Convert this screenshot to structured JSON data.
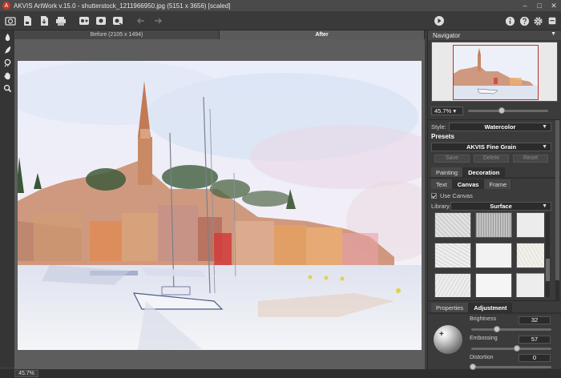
{
  "window": {
    "title": "AKVIS ArtWork v.15.0 - shutterstock_1211966950.jpg (5151 x 3656) [scaled]",
    "logo_letter": "A",
    "minimize": "–",
    "maximize": "□",
    "close": "✕"
  },
  "toolbar": {
    "left_icons": [
      "open-icon",
      "save-icon",
      "export-icon",
      "print-icon",
      "batch-icon",
      "share-icon",
      "settings-icon",
      "undo-icon",
      "redo-icon"
    ],
    "right_icons": [
      "run-icon",
      "info-icon",
      "help-icon",
      "settings-gear-icon",
      "notifications-icon"
    ]
  },
  "left_tools": [
    "brush-icon",
    "smudge-icon",
    "eraser-icon",
    "hand-icon",
    "zoom-icon"
  ],
  "view_tabs": {
    "before": "Before (2105 x 1494)",
    "after": "After"
  },
  "status": {
    "zoom": "45.7%"
  },
  "navigator": {
    "title": "Navigator",
    "zoom": "45.7%",
    "zoom_slider_fraction": 0.42
  },
  "settings": {
    "style_label": "Style:",
    "style_value": "Watercolor",
    "presets_title": "Presets",
    "preset_value": "AKVIS Fine Grain",
    "save_button": "Save",
    "delete_button": "Delete",
    "reset_button": "Reset",
    "tabs": [
      "Painting",
      "Decoration"
    ],
    "active_tab": "Decoration",
    "subtabs": [
      "Text",
      "Canvas",
      "Frame"
    ],
    "active_subtab": "Canvas",
    "use_canvas_label": "Use Canvas",
    "library_label": "Library",
    "library_value": "Surface"
  },
  "bottom_panel": {
    "tabs": [
      "Properties",
      "Adjustment"
    ],
    "active_tab": "Adjustment",
    "brightness_label": "Brightness",
    "brightness_value": "32",
    "brightness_fraction": 0.32,
    "embossing_label": "Embossing",
    "embossing_value": "57",
    "embossing_fraction": 0.57,
    "distortion_label": "Distortion",
    "distortion_value": "0",
    "distortion_fraction": 0.0
  },
  "colors": {
    "accent_red": "#c0392b",
    "panel_bg": "#3b3b3b",
    "canvas_bg": "#5d5d5d"
  }
}
